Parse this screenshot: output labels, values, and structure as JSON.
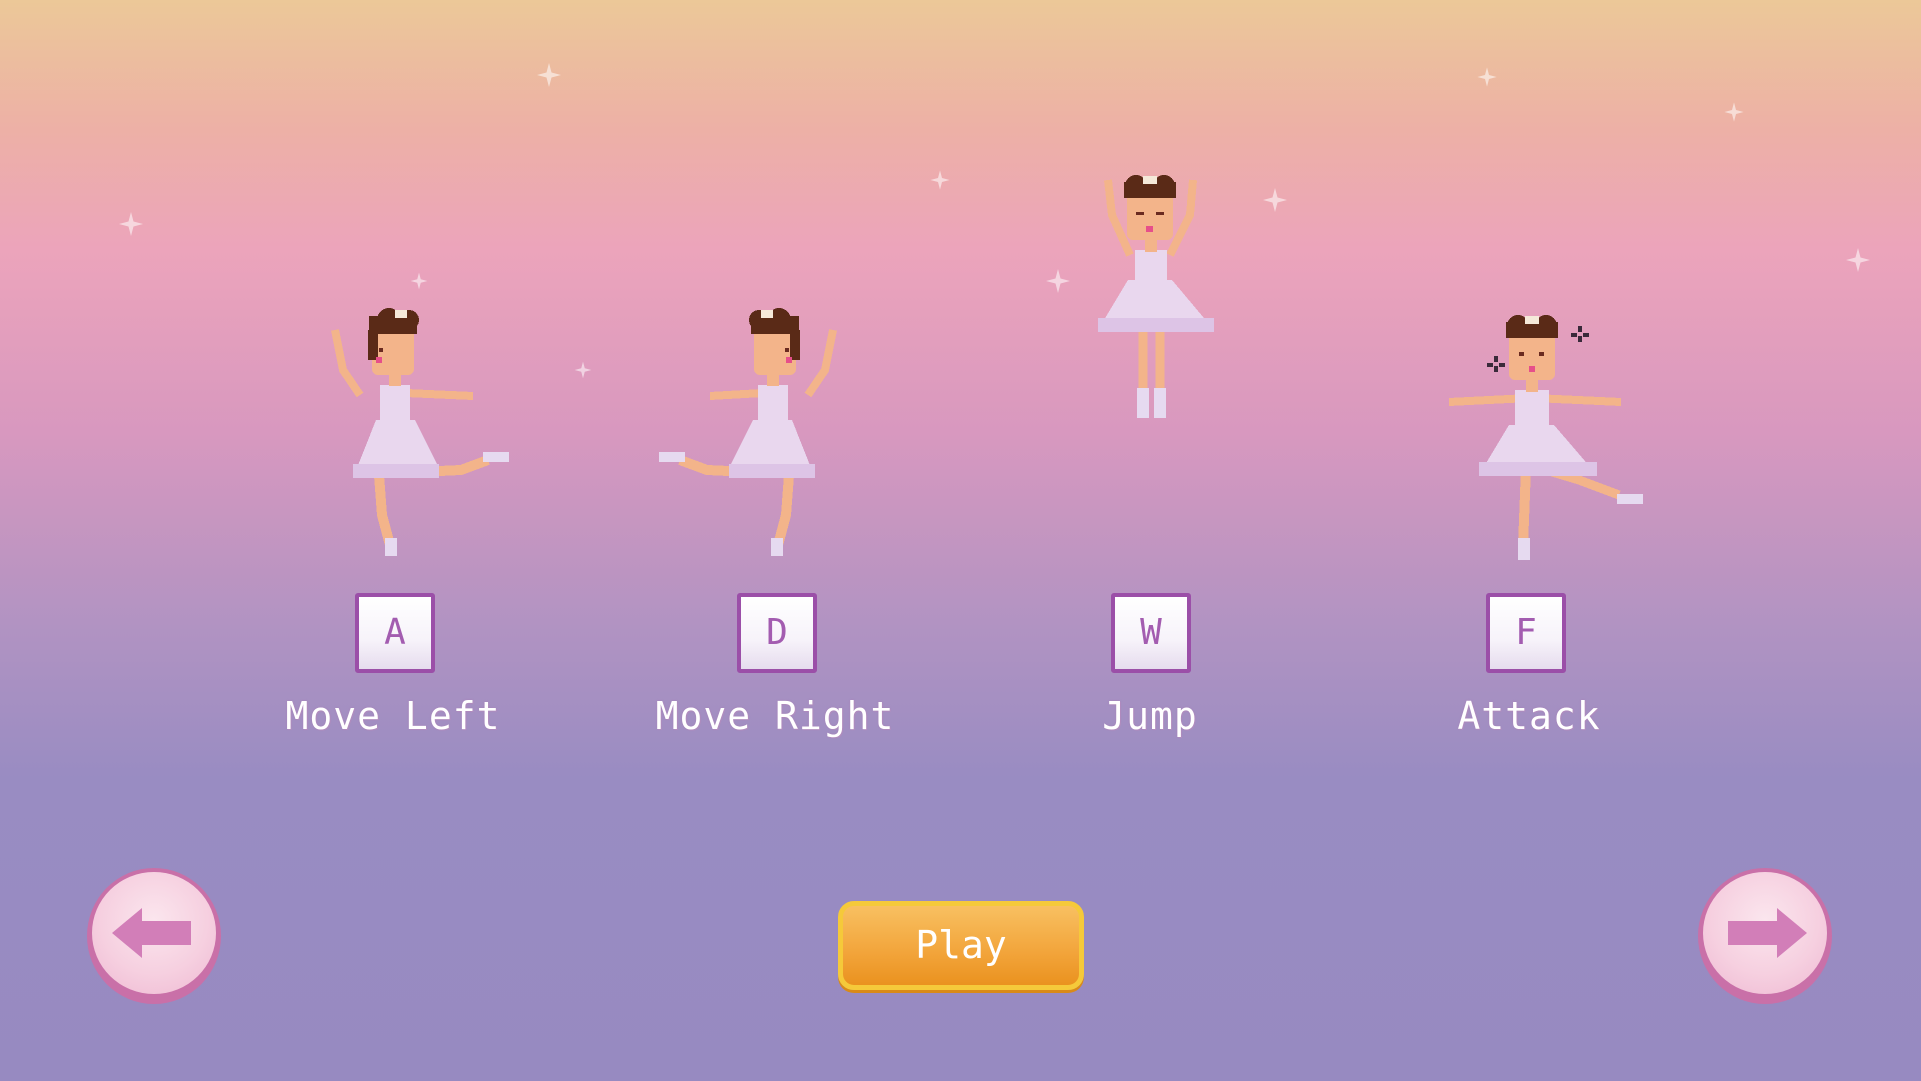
{
  "controls": [
    {
      "key": "A",
      "label": "Move Left",
      "pose": "arabesque-left"
    },
    {
      "key": "D",
      "label": "Move Right",
      "pose": "arabesque-right"
    },
    {
      "key": "W",
      "label": "Jump",
      "pose": "jump"
    },
    {
      "key": "F",
      "label": "Attack",
      "pose": "attack"
    }
  ],
  "play_button": {
    "label": "Play"
  },
  "nav": {
    "prev_icon": "arrow-left-icon",
    "next_icon": "arrow-right-icon"
  },
  "colors": {
    "key_border": "#9b4fa8",
    "play_button": "#f2a43a",
    "nav_button": "#f6d0e0",
    "nav_arrow": "#d27eb8",
    "dress": "#e9d7ee",
    "hair": "#5a2a17",
    "skin": "#f3b48a"
  }
}
